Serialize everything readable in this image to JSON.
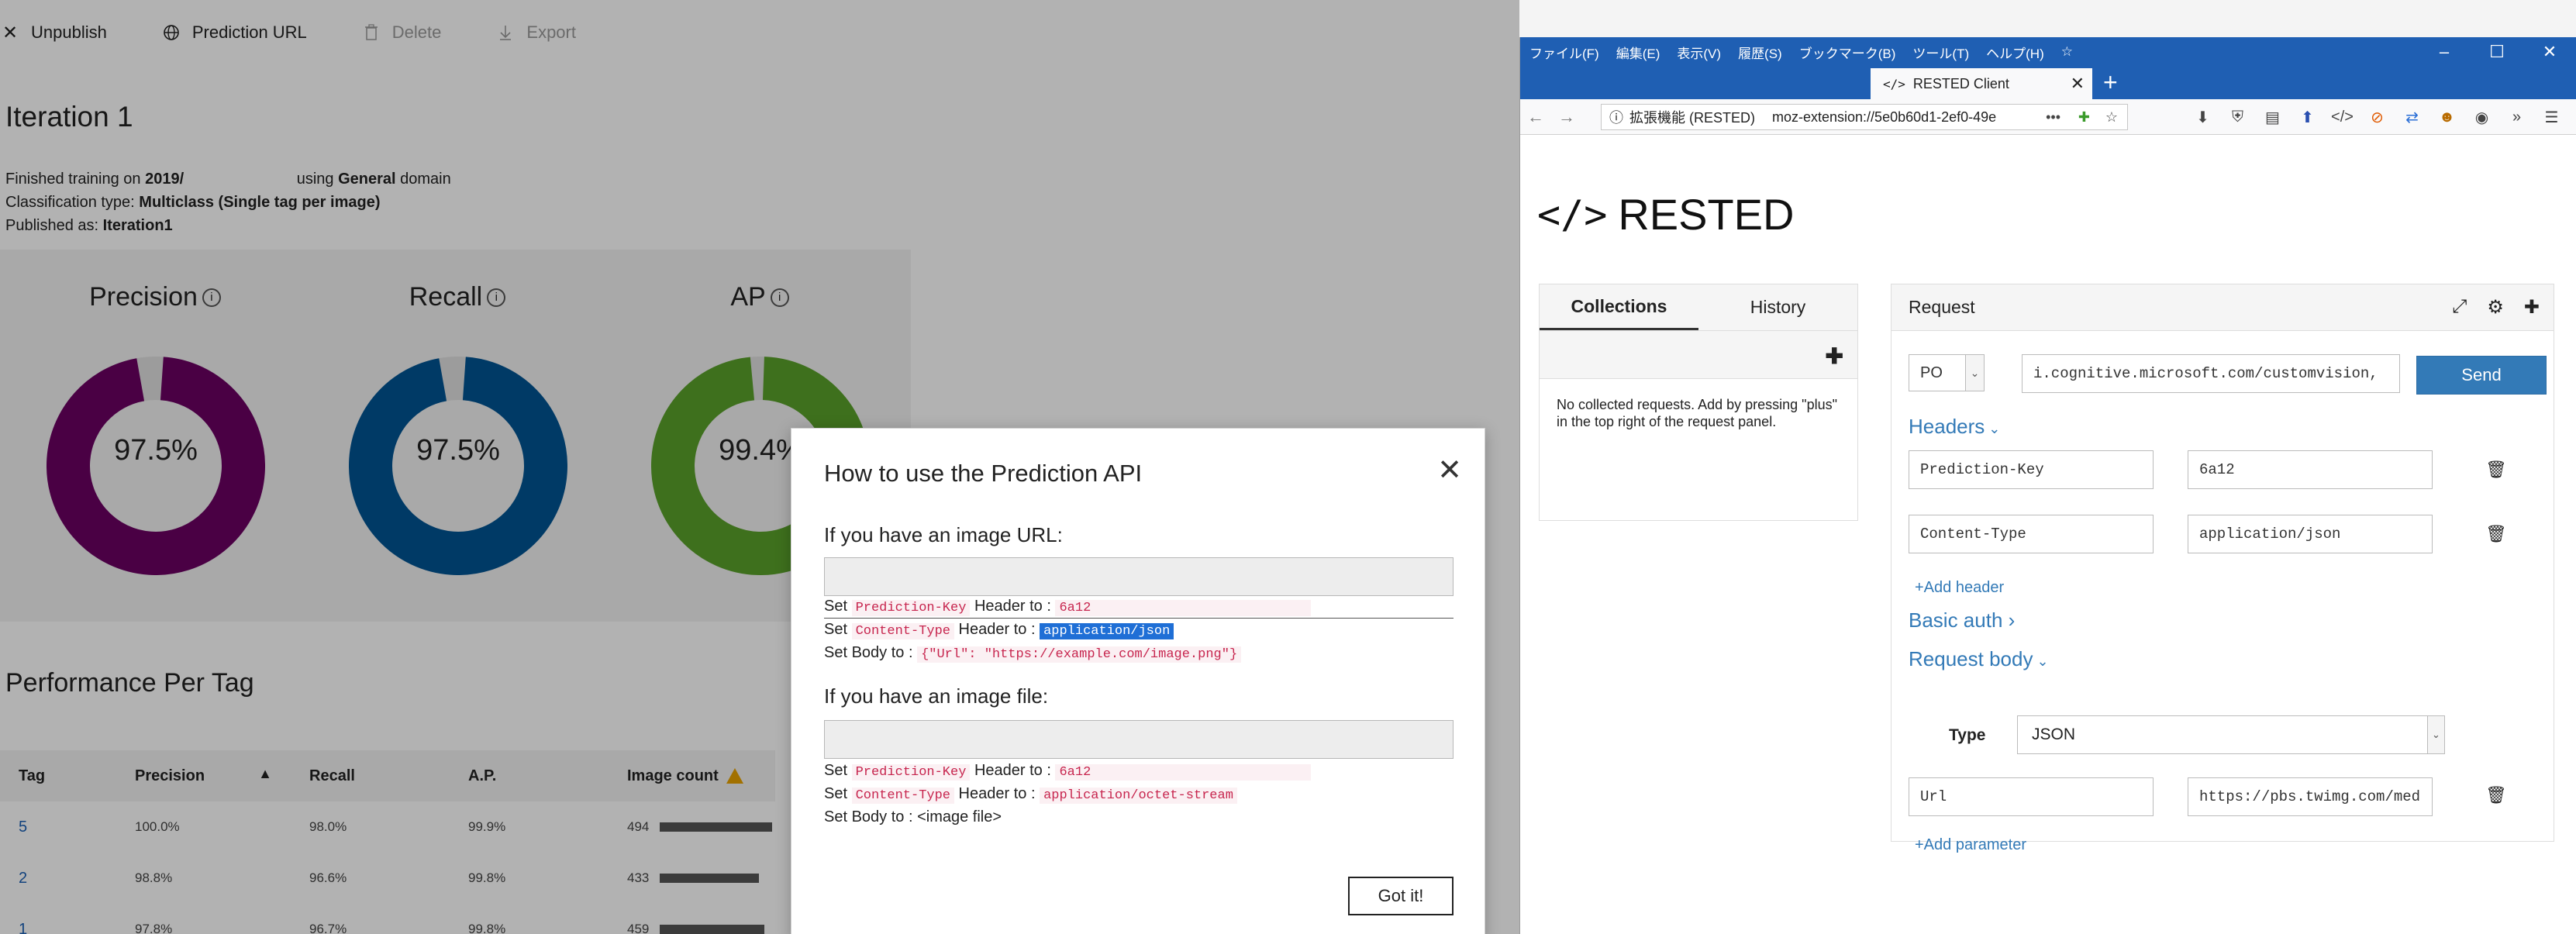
{
  "toolbar": {
    "unpublish": "Unpublish",
    "prediction_url": "Prediction URL",
    "delete": "Delete",
    "export": "Export"
  },
  "iteration": {
    "title": "Iteration 1",
    "finished_prefix": "Finished training on ",
    "finished_date": "2019/",
    "finished_mid": " using ",
    "domain": "General",
    "domain_suffix": " domain",
    "class_type_label": "Classification type: ",
    "class_type": "Multiclass (Single tag per image)",
    "published_label": "Published as: ",
    "published_name": "Iteration1"
  },
  "metrics": [
    {
      "label": "Precision",
      "value": "97.5%",
      "fraction": 0.975,
      "color": "#6b0062"
    },
    {
      "label": "Recall",
      "value": "97.5%",
      "fraction": 0.975,
      "color": "#005393"
    },
    {
      "label": "AP",
      "value": "99.4%",
      "fraction": 0.994,
      "color": "#5aa12a"
    }
  ],
  "performance": {
    "title": "Performance Per Tag",
    "columns": [
      "Tag",
      "Precision",
      "Recall",
      "A.P.",
      "Image count"
    ],
    "rows": [
      {
        "tag": "5",
        "precision": "100.0%",
        "recall": "98.0%",
        "ap": "99.9%",
        "count": "494",
        "bar": 1.0
      },
      {
        "tag": "2",
        "precision": "98.8%",
        "recall": "96.6%",
        "ap": "99.8%",
        "count": "433",
        "bar": 0.88
      },
      {
        "tag": "1",
        "precision": "97.8%",
        "recall": "96.7%",
        "ap": "99.8%",
        "count": "459",
        "bar": 0.93
      }
    ]
  },
  "dialog": {
    "title": "How to use the Prediction API",
    "close_glyph": "✕",
    "url_section": "If you have an image URL:",
    "file_section": "If you have an image file:",
    "set": "Set ",
    "header_to": " Header to : ",
    "body_to": "Set Body to : ",
    "pred_key_name": "Prediction-Key",
    "pred_key_val": "6a12",
    "content_type_name": "Content-Type",
    "url_content_type": "application/json",
    "url_body": "{\"Url\": \"https://example.com/image.png\"}",
    "file_content_type": "application/octet-stream",
    "file_body": "<image file>",
    "got_it": "Got it!"
  },
  "firefox": {
    "menu": [
      "ファイル(F)",
      "編集(E)",
      "表示(V)",
      "履歴(S)",
      "ブックマーク(B)",
      "ツール(T)",
      "ヘルプ(H)"
    ],
    "tab_title": "RESTED Client",
    "url_ext": "拡張機能 (RESTED)",
    "url": "moz-extension://5e0b60d1-2ef0-49e",
    "dots": "•••"
  },
  "rested": {
    "logo": "RESTED",
    "logo_glyph": "</>",
    "collections_tab": "Collections",
    "history_tab": "History",
    "empty_text": "No collected requests. Add by pressing \"plus\" in the top right of the request panel.",
    "request_title": "Request",
    "method": "PO",
    "url_value": "i.cognitive.microsoft.com/customvision,",
    "send": "Send",
    "headers_link": "Headers",
    "headers": [
      {
        "name": "Prediction-Key",
        "value": "6a12"
      },
      {
        "name": "Content-Type",
        "value": "application/json"
      }
    ],
    "add_header": "+Add header",
    "basic_auth": "Basic auth ›",
    "request_body": "Request body",
    "type_label": "Type",
    "type_value": "JSON",
    "param_name": "Url",
    "param_value": "https://pbs.twimg.com/med",
    "add_parameter": "+Add parameter"
  }
}
